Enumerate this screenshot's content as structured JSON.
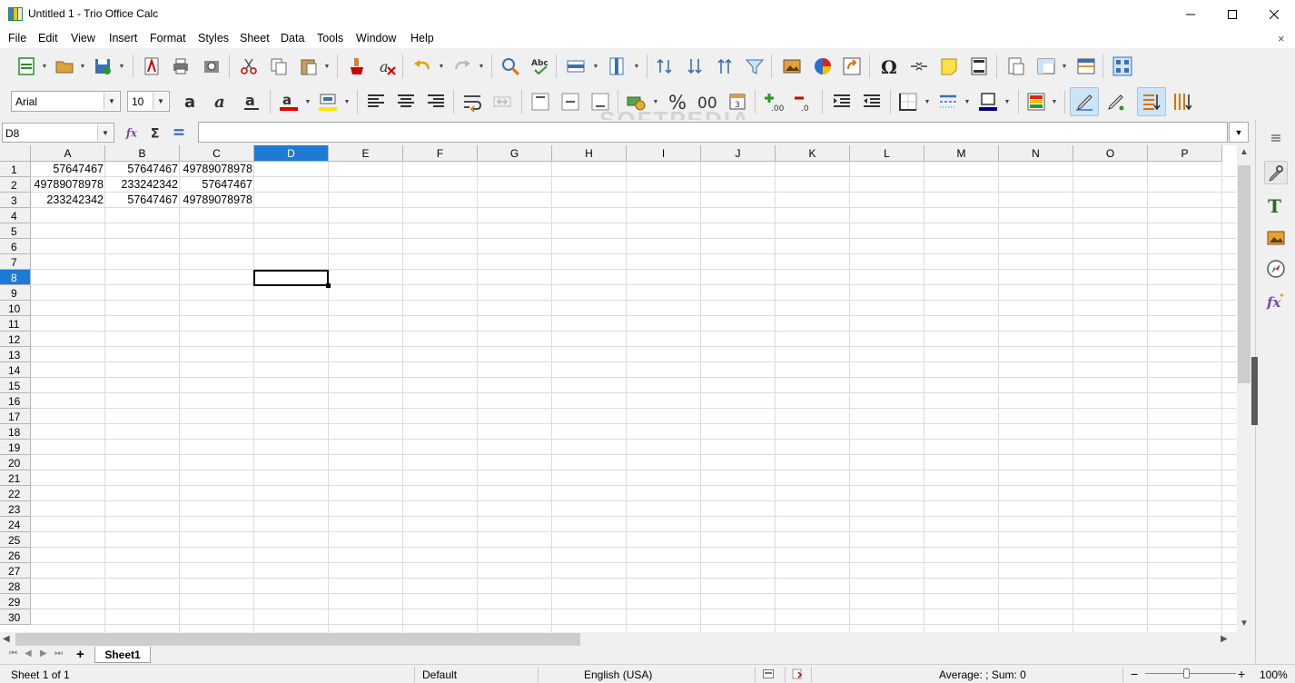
{
  "window": {
    "title": "Untitled 1 - Trio Office Calc",
    "minimize_glyph": "—",
    "maximize_glyph": "☐",
    "close_glyph": "✕"
  },
  "menu": {
    "items": [
      "File",
      "Edit",
      "View",
      "Insert",
      "Format",
      "Styles",
      "Sheet",
      "Data",
      "Tools",
      "Window",
      "Help"
    ],
    "close_doc_glyph": "×"
  },
  "formatting": {
    "font_name": "Arial",
    "font_size": "10"
  },
  "watermark": "SOFTPEDIA",
  "formula_bar": {
    "name_box": "D8",
    "formula": ""
  },
  "sheet": {
    "columns": [
      "A",
      "B",
      "C",
      "D",
      "E",
      "F",
      "G",
      "H",
      "I",
      "J",
      "K",
      "L",
      "M",
      "N",
      "O",
      "P"
    ],
    "selected_column": "D",
    "rows": [
      "1",
      "2",
      "3",
      "4",
      "5",
      "6",
      "7",
      "8",
      "9",
      "10",
      "11",
      "12",
      "13",
      "14",
      "15",
      "16",
      "17",
      "18",
      "19",
      "20",
      "21",
      "22",
      "23",
      "24",
      "25",
      "26",
      "27",
      "28",
      "29",
      "30"
    ],
    "selected_row": "8",
    "cells": [
      [
        "57647467",
        "57647467",
        "49789078978"
      ],
      [
        "49789078978",
        "233242342",
        "57647467"
      ],
      [
        "233242342",
        "57647467",
        "49789078978"
      ]
    ]
  },
  "tabs": {
    "add_glyph": "+",
    "sheets": [
      "Sheet1"
    ]
  },
  "status": {
    "sheet_info": "Sheet 1 of 1",
    "page_style": "Default",
    "language": "English (USA)",
    "summary": "Average: ; Sum: 0",
    "zoom": "100%",
    "zoom_minus": "−",
    "zoom_plus": "+"
  },
  "colors": {
    "selection_blue": "#1e7bd4",
    "font_color_bar": "#e00000",
    "highlight_bar": "#ffe600",
    "border_color_bar": "#000080"
  }
}
